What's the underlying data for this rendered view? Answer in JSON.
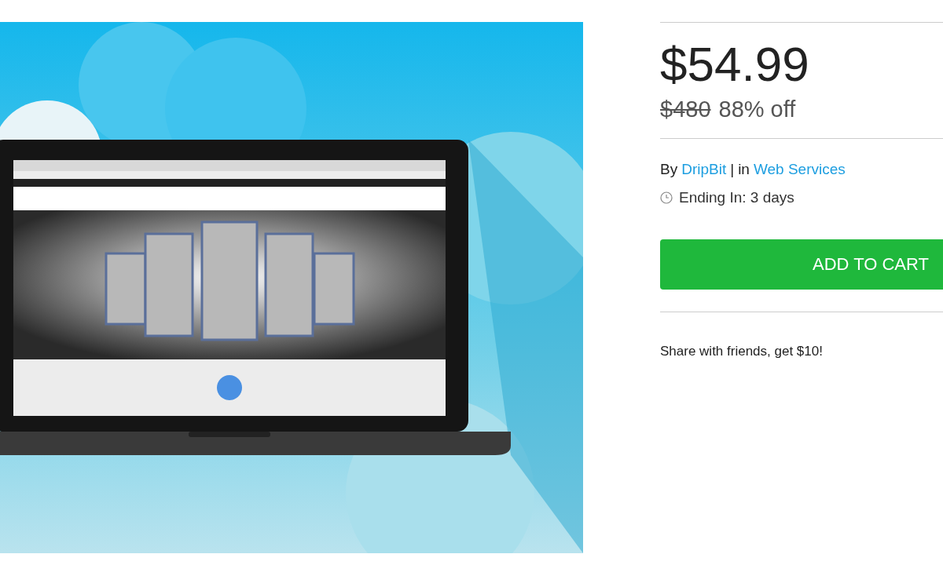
{
  "price": "$54.99",
  "original_price": "$480",
  "discount": "88% off",
  "vendor": {
    "prefix": "By",
    "name": "DripBit",
    "separator": "|",
    "category_prefix": "in",
    "category": "Web Services"
  },
  "ending": "Ending In: 3 days",
  "add_to_cart": "ADD TO CART",
  "share": "Share with friends, get $10!"
}
